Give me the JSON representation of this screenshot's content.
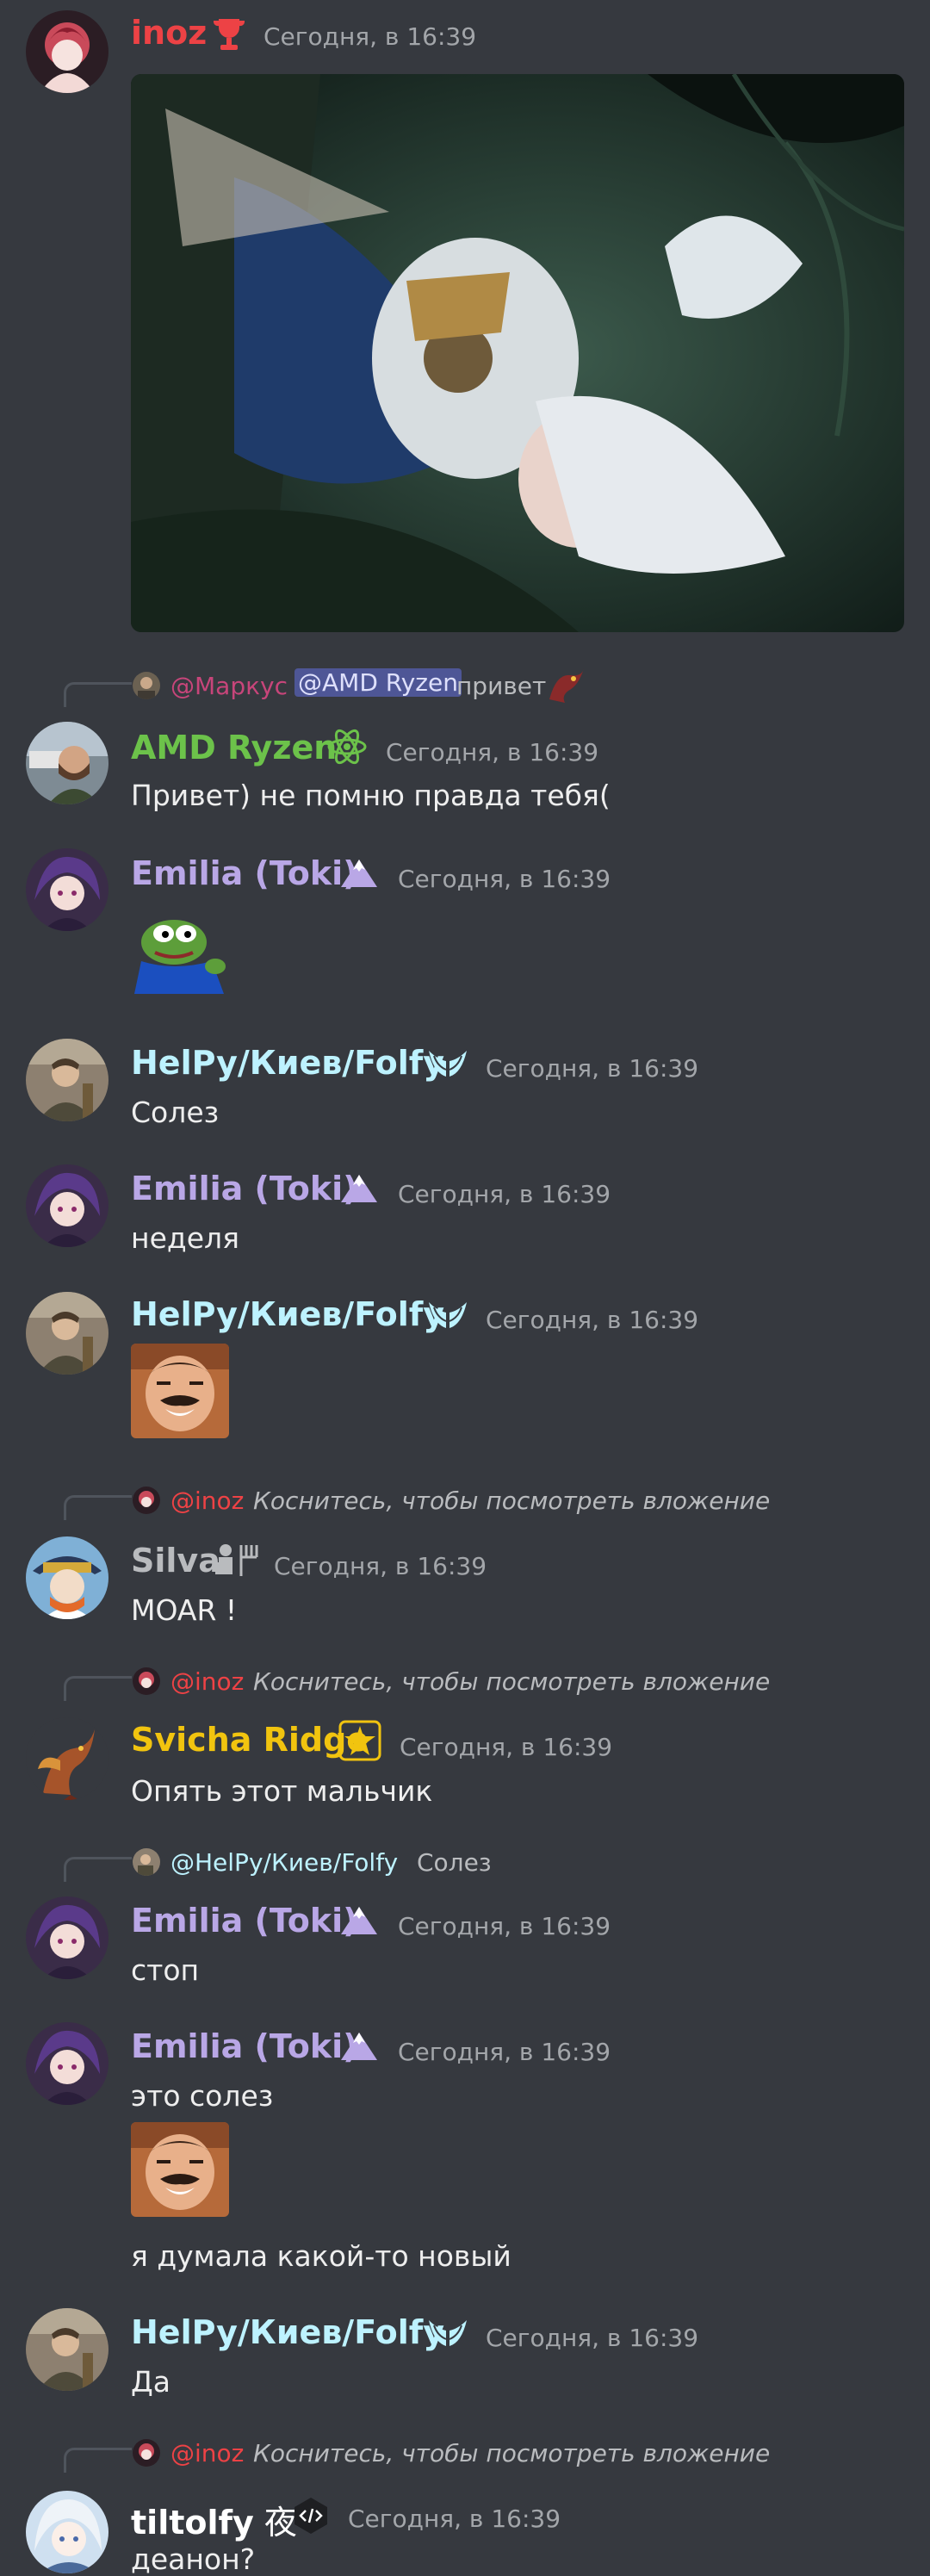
{
  "colors": {
    "background": "#36393f",
    "inoz": "#ed4245",
    "amd": "#6cc24a",
    "emilia": "#b9a7e6",
    "helpy": "#bdf2ff",
    "silva": "#b9bbbe",
    "svicha": "#f1c40f",
    "tiltolfy": "#ffffff",
    "mention_bg": "#4e5696",
    "mention_fg": "#dee0fc"
  },
  "messages": [
    {
      "author": "inoz",
      "timestamp": "Сегодня, в 16:39"
    },
    {
      "reply": {
        "mention1": "@Маркус",
        "mention2": "@AMD Ryzen",
        "text": "привет"
      },
      "author": "AMD Ryzen",
      "timestamp": "Сегодня, в 16:39",
      "text": "Привет) не помню правда тебя("
    },
    {
      "author": "Emilia (Toki)",
      "timestamp": "Сегодня, в 16:39"
    },
    {
      "author": "HelPy/Киев/Folfy",
      "timestamp": "Сегодня, в 16:39",
      "text": "Солез"
    },
    {
      "author": "Emilia (Toki)",
      "timestamp": "Сегодня, в 16:39",
      "text": "неделя"
    },
    {
      "author": "HelPy/Киев/Folfy",
      "timestamp": "Сегодня, в 16:39"
    },
    {
      "reply": {
        "mention": "@inoz",
        "text": "Коснитесь, чтобы посмотреть вложение"
      },
      "author": "Silva",
      "timestamp": "Сегодня, в 16:39",
      "text": "MOAR !"
    },
    {
      "reply": {
        "mention": "@inoz",
        "text": "Коснитесь, чтобы посмотреть вложение"
      },
      "author": "Svicha Ridge",
      "timestamp": "Сегодня, в 16:39",
      "text": "Опять этот мальчик"
    },
    {
      "reply": {
        "mention": "@HelPy/Киев/Folfy",
        "text": "Солез"
      },
      "author": "Emilia (Toki)",
      "timestamp": "Сегодня, в 16:39",
      "text": "стоп"
    },
    {
      "author": "Emilia (Toki)",
      "timestamp": "Сегодня, в 16:39",
      "text": "это солез",
      "text2": "я думала какой-то новый"
    },
    {
      "author": "HelPy/Киев/Folfy",
      "timestamp": "Сегодня, в 16:39",
      "text": "Да"
    },
    {
      "reply": {
        "mention": "@inoz",
        "text": "Коснитесь, чтобы посмотреть вложение"
      },
      "author": "tiltolfy",
      "author_suffix": "夜",
      "timestamp": "Сегодня, в 16:39",
      "text": "деанон?"
    }
  ]
}
